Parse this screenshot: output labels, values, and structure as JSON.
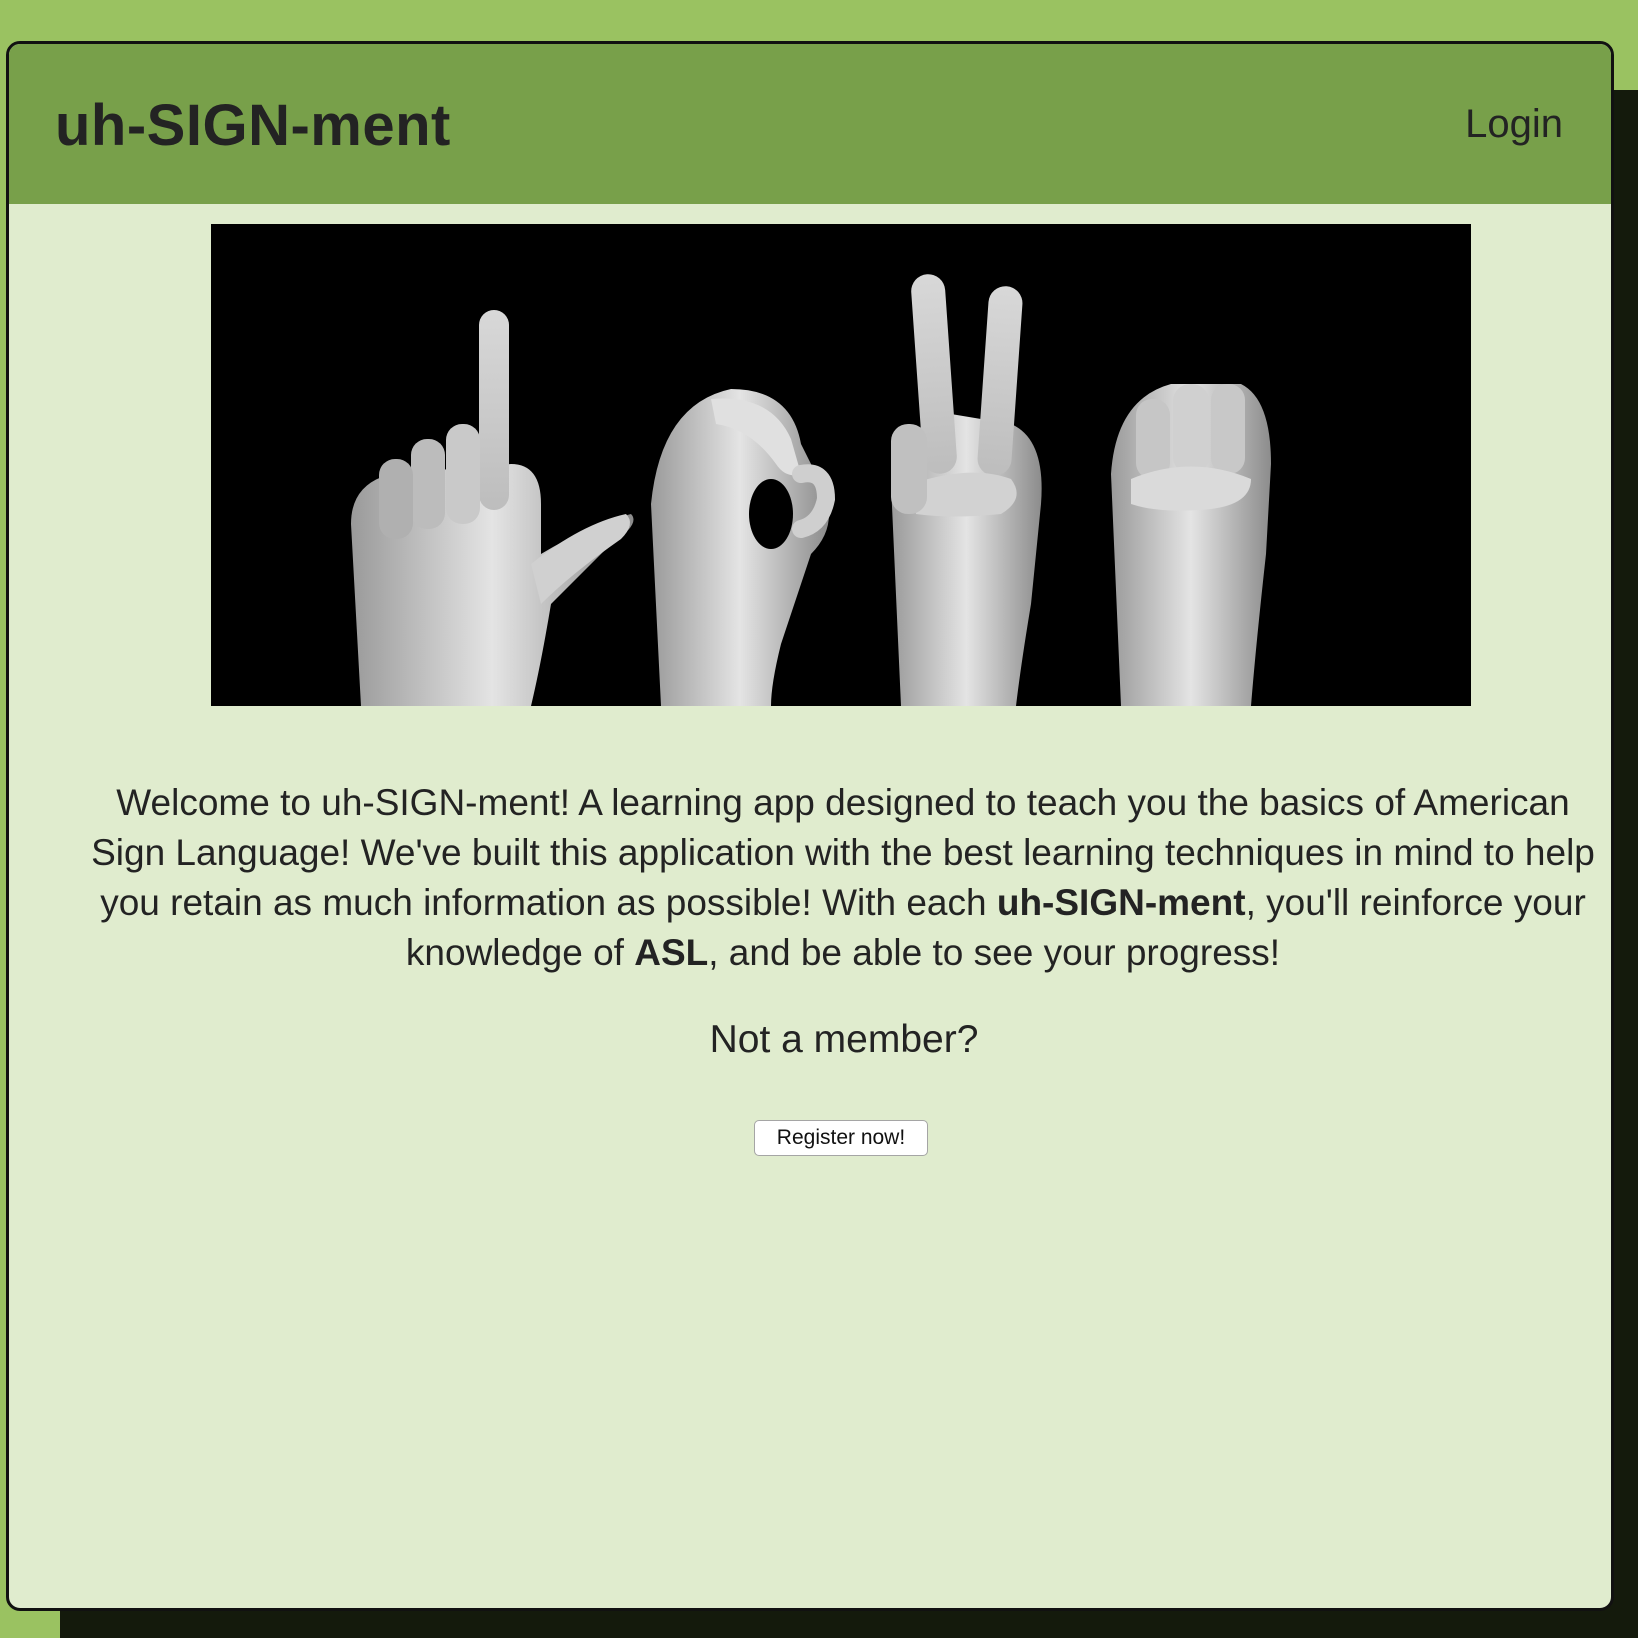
{
  "header": {
    "brand": "uh-SIGN-ment",
    "login_label": "Login"
  },
  "hero": {
    "image_semantic": "asl-love-hands-banner",
    "letters_signed": [
      "L",
      "O",
      "V",
      "E"
    ]
  },
  "intro": {
    "lines": [
      "Welcome to uh-SIGN-ment! A learning app designed to teach you the basics of American",
      "Sign Language! We've built this application with the best learning techniques in mind to help",
      "you retain as much information as possible! With each ",
      "uh-SIGN-ment",
      ", you'll reinforce your",
      "knowledge of ",
      "ASL",
      ", and be able to see your progress!"
    ]
  },
  "cta": {
    "prompt": "Not a member?",
    "register_label": "Register now!"
  },
  "colors": {
    "page_bg": "#9ac261",
    "header_bg": "#78a04a",
    "content_bg": "#e0ecce",
    "text": "#232323"
  }
}
